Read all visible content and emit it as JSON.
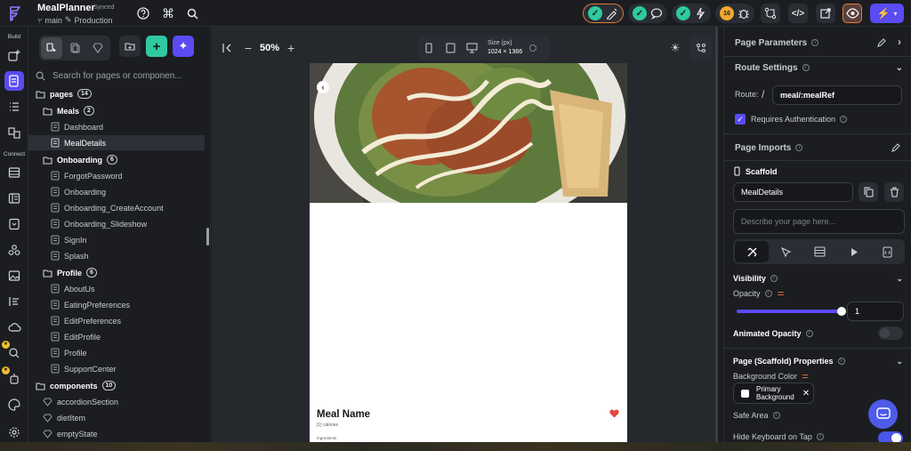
{
  "app": {
    "project_name": "MealPlanner",
    "sync_status": "Synced",
    "branch": "main",
    "environment": "Production"
  },
  "rail": {
    "build_label": "Build",
    "connect_label": "Connect"
  },
  "tree": {
    "search_placeholder": "Search for pages or componen...",
    "pages": {
      "label": "pages",
      "count": "14"
    },
    "meals": {
      "label": "Meals",
      "count": "2",
      "items": [
        "Dashboard",
        "MealDetails"
      ]
    },
    "onboarding": {
      "label": "Onboarding",
      "count": "6",
      "items": [
        "ForgotPassword",
        "Onboarding",
        "Onboarding_CreateAccount",
        "Onboarding_Slideshow",
        "SignIn",
        "Splash"
      ]
    },
    "profile": {
      "label": "Profile",
      "count": "6",
      "items": [
        "AboutUs",
        "EatingPreferences",
        "EditPreferences",
        "EditProfile",
        "Profile",
        "SupportCenter"
      ]
    },
    "components": {
      "label": "components",
      "count": "10",
      "items": [
        "accordionSection",
        "dietItem",
        "emptyState"
      ]
    }
  },
  "canvas": {
    "zoom": "50%",
    "size_label": "Size (px)",
    "size_value": "1024 × 1366"
  },
  "preview": {
    "meal_name": "Meal Name",
    "calories": "[1] calories",
    "ingredients": "Ingredients"
  },
  "props": {
    "page_parameters": "Page Parameters",
    "route_settings": "Route Settings",
    "route_label": "Route:",
    "route_slash": "/",
    "route_value": "meal/:mealRef",
    "requires_auth": "Requires Authentication",
    "page_imports": "Page Imports",
    "scaffold": "Scaffold",
    "page_name": "MealDetails",
    "description_placeholder": "Describe your page here...",
    "visibility": "Visibility",
    "opacity_label": "Opacity",
    "opacity_value": "1",
    "opacity_fraction": 1,
    "animated_opacity": "Animated Opacity",
    "scaffold_properties": "Page (Scaffold) Properties",
    "background_color_label": "Background Color",
    "background_color_value_line1": "Primary",
    "background_color_value_line2": "Background",
    "safe_area": "Safe Area",
    "hide_keyboard": "Hide Keyboard on Tap"
  },
  "colors": {
    "accent": "#5a4bf2",
    "success": "#2ec9a0",
    "heart": "#e0483d",
    "chat": "#4d5be8"
  }
}
